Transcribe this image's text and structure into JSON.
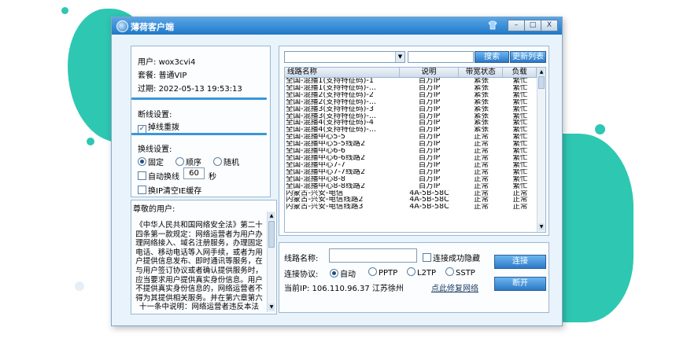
{
  "window": {
    "title": "薄荷客户端",
    "buttons": [
      "?",
      "□",
      "X"
    ]
  },
  "account": {
    "user_label": "用户:",
    "user": "wox3cvi4",
    "plan_label": "套餐:",
    "plan": "普通VIP",
    "expire_label": "过期:",
    "expire": "2022-05-13 19:53:13"
  },
  "disconnect": {
    "title": "断线设置:",
    "reconnect_label": "掉线重拨",
    "reconnect_checked": true
  },
  "switch": {
    "title": "换线设置:",
    "modes": [
      {
        "label": "固定",
        "selected": true
      },
      {
        "label": "顺序",
        "selected": false
      },
      {
        "label": "随机",
        "selected": false
      }
    ],
    "auto_label": "自动换线",
    "auto_value": "60",
    "auto_unit": "秒",
    "clear_ie_label": "换IP清空IE缓存"
  },
  "notice": {
    "title": "尊敬的用户:",
    "body": "《中华人民共和国网络安全法》第二十四条第一款规定：网络运营者为用户办理网络接入、域名注册服务，办理固定电话、移动电话等入网手续，或者为用户提供信息发布、即时通讯等服务，在与用户签订协议或者确认提供服务时，应当要求用户提供真实身份信息。用户不提供真实身份信息的，网络运营者不得为其提供相关服务。并在第六章第六十一条中说明：网络运营者违反本法"
  },
  "search": {
    "search_button": "搜索",
    "refresh_button": "更新列表",
    "dropdown_value": "",
    "keyword_value": ""
  },
  "table": {
    "columns": [
      "线路名称",
      "说明",
      "带宽状态",
      "负载"
    ],
    "rows": [
      [
        "全国-混播1(支持特征码)-1",
        "百万IP",
        "紧张",
        "繁忙"
      ],
      [
        "全国-混播1(支持特征码)-...",
        "百万IP",
        "紧张",
        "繁忙"
      ],
      [
        "全国-混播2(支持特征码)-2",
        "百万IP",
        "紧张",
        "繁忙"
      ],
      [
        "全国-混播2(支持特征码)-...",
        "百万IP",
        "紧张",
        "繁忙"
      ],
      [
        "全国-混播3(支持特征码)-3",
        "百万IP",
        "紧张",
        "繁忙"
      ],
      [
        "全国-混播3(支持特征码)-...",
        "百万IP",
        "紧张",
        "繁忙"
      ],
      [
        "全国-混播4(支持特征码)-4",
        "百万IP",
        "紧张",
        "繁忙"
      ],
      [
        "全国-混播4(支持特征码)-...",
        "百万IP",
        "紧张",
        "繁忙"
      ],
      [
        "全国-混播中心5-5",
        "百万IP",
        "正常",
        "繁忙"
      ],
      [
        "全国-混播中心5-5线路2",
        "百万IP",
        "正常",
        "繁忙"
      ],
      [
        "全国-混播中心6-6",
        "百万IP",
        "正常",
        "繁忙"
      ],
      [
        "全国-混播中心6-6线路2",
        "百万IP",
        "正常",
        "繁忙"
      ],
      [
        "全国-混播中心7-7",
        "百万IP",
        "正常",
        "繁忙"
      ],
      [
        "全国-混播中心7-7线路2",
        "百万IP",
        "正常",
        "繁忙"
      ],
      [
        "全国-混播中心8-8",
        "百万IP",
        "正常",
        "繁忙"
      ],
      [
        "全国-混播中心8-8线路2",
        "百万IP",
        "正常",
        "繁忙"
      ],
      [
        "内蒙古-兴安-电信",
        "4A-5B-58C",
        "正常",
        "正常"
      ],
      [
        "内蒙古-兴安-电信线路2",
        "4A-5B-58C",
        "正常",
        "正常"
      ],
      [
        "内蒙古-兴安-电信线路3",
        "4A-5B-58C",
        "正常",
        "正常"
      ]
    ]
  },
  "connect": {
    "line_label": "线路名称:",
    "line_value": "",
    "hide_label": "连接成功隐藏",
    "protocol_label": "连接协议:",
    "protocols": [
      {
        "label": "自动",
        "selected": true
      },
      {
        "label": "PPTP",
        "selected": false
      },
      {
        "label": "L2TP",
        "selected": false
      },
      {
        "label": "SSTP",
        "selected": false
      }
    ],
    "ip_label": "当前IP:",
    "ip": "106.110.96.37",
    "location": "江苏徐州",
    "repair_link": "点此修复网络",
    "connect_button": "连接",
    "disconnect_button": "断开"
  },
  "colors": {
    "accent": "#27c7b4",
    "titlebar": "#2a82d0",
    "button": "#3d8fd9"
  }
}
